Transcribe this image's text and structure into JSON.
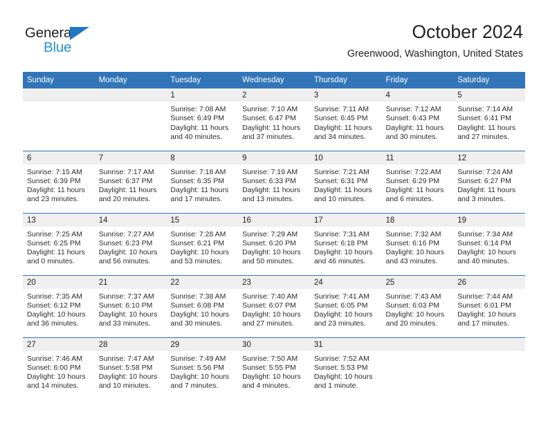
{
  "brand": {
    "name_top": "General",
    "name_bottom": "Blue",
    "triangle_color": "#1f77c2",
    "text_color": "#231f20",
    "blue_color": "#2a8fd8"
  },
  "header": {
    "month_title": "October 2024",
    "location": "Greenwood, Washington, United States"
  },
  "theme": {
    "header_blue": "#3275b8",
    "daynum_band": "#efefef",
    "text": "#222222"
  },
  "weekday_headers": [
    "Sunday",
    "Monday",
    "Tuesday",
    "Wednesday",
    "Thursday",
    "Friday",
    "Saturday"
  ],
  "labels": {
    "sunrise_prefix": "Sunrise:",
    "sunset_prefix": "Sunset:",
    "daylight_prefix": "Daylight:"
  },
  "weeks": [
    [
      {
        "day": ""
      },
      {
        "day": ""
      },
      {
        "day": "1",
        "sunrise": "Sunrise: 7:08 AM",
        "sunset": "Sunset: 6:49 PM",
        "daylight": "Daylight: 11 hours and 40 minutes."
      },
      {
        "day": "2",
        "sunrise": "Sunrise: 7:10 AM",
        "sunset": "Sunset: 6:47 PM",
        "daylight": "Daylight: 11 hours and 37 minutes."
      },
      {
        "day": "3",
        "sunrise": "Sunrise: 7:11 AM",
        "sunset": "Sunset: 6:45 PM",
        "daylight": "Daylight: 11 hours and 34 minutes."
      },
      {
        "day": "4",
        "sunrise": "Sunrise: 7:12 AM",
        "sunset": "Sunset: 6:43 PM",
        "daylight": "Daylight: 11 hours and 30 minutes."
      },
      {
        "day": "5",
        "sunrise": "Sunrise: 7:14 AM",
        "sunset": "Sunset: 6:41 PM",
        "daylight": "Daylight: 11 hours and 27 minutes."
      }
    ],
    [
      {
        "day": "6",
        "sunrise": "Sunrise: 7:15 AM",
        "sunset": "Sunset: 6:39 PM",
        "daylight": "Daylight: 11 hours and 23 minutes."
      },
      {
        "day": "7",
        "sunrise": "Sunrise: 7:17 AM",
        "sunset": "Sunset: 6:37 PM",
        "daylight": "Daylight: 11 hours and 20 minutes."
      },
      {
        "day": "8",
        "sunrise": "Sunrise: 7:18 AM",
        "sunset": "Sunset: 6:35 PM",
        "daylight": "Daylight: 11 hours and 17 minutes."
      },
      {
        "day": "9",
        "sunrise": "Sunrise: 7:19 AM",
        "sunset": "Sunset: 6:33 PM",
        "daylight": "Daylight: 11 hours and 13 minutes."
      },
      {
        "day": "10",
        "sunrise": "Sunrise: 7:21 AM",
        "sunset": "Sunset: 6:31 PM",
        "daylight": "Daylight: 11 hours and 10 minutes."
      },
      {
        "day": "11",
        "sunrise": "Sunrise: 7:22 AM",
        "sunset": "Sunset: 6:29 PM",
        "daylight": "Daylight: 11 hours and 6 minutes."
      },
      {
        "day": "12",
        "sunrise": "Sunrise: 7:24 AM",
        "sunset": "Sunset: 6:27 PM",
        "daylight": "Daylight: 11 hours and 3 minutes."
      }
    ],
    [
      {
        "day": "13",
        "sunrise": "Sunrise: 7:25 AM",
        "sunset": "Sunset: 6:25 PM",
        "daylight": "Daylight: 11 hours and 0 minutes."
      },
      {
        "day": "14",
        "sunrise": "Sunrise: 7:27 AM",
        "sunset": "Sunset: 6:23 PM",
        "daylight": "Daylight: 10 hours and 56 minutes."
      },
      {
        "day": "15",
        "sunrise": "Sunrise: 7:28 AM",
        "sunset": "Sunset: 6:21 PM",
        "daylight": "Daylight: 10 hours and 53 minutes."
      },
      {
        "day": "16",
        "sunrise": "Sunrise: 7:29 AM",
        "sunset": "Sunset: 6:20 PM",
        "daylight": "Daylight: 10 hours and 50 minutes."
      },
      {
        "day": "17",
        "sunrise": "Sunrise: 7:31 AM",
        "sunset": "Sunset: 6:18 PM",
        "daylight": "Daylight: 10 hours and 46 minutes."
      },
      {
        "day": "18",
        "sunrise": "Sunrise: 7:32 AM",
        "sunset": "Sunset: 6:16 PM",
        "daylight": "Daylight: 10 hours and 43 minutes."
      },
      {
        "day": "19",
        "sunrise": "Sunrise: 7:34 AM",
        "sunset": "Sunset: 6:14 PM",
        "daylight": "Daylight: 10 hours and 40 minutes."
      }
    ],
    [
      {
        "day": "20",
        "sunrise": "Sunrise: 7:35 AM",
        "sunset": "Sunset: 6:12 PM",
        "daylight": "Daylight: 10 hours and 36 minutes."
      },
      {
        "day": "21",
        "sunrise": "Sunrise: 7:37 AM",
        "sunset": "Sunset: 6:10 PM",
        "daylight": "Daylight: 10 hours and 33 minutes."
      },
      {
        "day": "22",
        "sunrise": "Sunrise: 7:38 AM",
        "sunset": "Sunset: 6:08 PM",
        "daylight": "Daylight: 10 hours and 30 minutes."
      },
      {
        "day": "23",
        "sunrise": "Sunrise: 7:40 AM",
        "sunset": "Sunset: 6:07 PM",
        "daylight": "Daylight: 10 hours and 27 minutes."
      },
      {
        "day": "24",
        "sunrise": "Sunrise: 7:41 AM",
        "sunset": "Sunset: 6:05 PM",
        "daylight": "Daylight: 10 hours and 23 minutes."
      },
      {
        "day": "25",
        "sunrise": "Sunrise: 7:43 AM",
        "sunset": "Sunset: 6:03 PM",
        "daylight": "Daylight: 10 hours and 20 minutes."
      },
      {
        "day": "26",
        "sunrise": "Sunrise: 7:44 AM",
        "sunset": "Sunset: 6:01 PM",
        "daylight": "Daylight: 10 hours and 17 minutes."
      }
    ],
    [
      {
        "day": "27",
        "sunrise": "Sunrise: 7:46 AM",
        "sunset": "Sunset: 6:00 PM",
        "daylight": "Daylight: 10 hours and 14 minutes."
      },
      {
        "day": "28",
        "sunrise": "Sunrise: 7:47 AM",
        "sunset": "Sunset: 5:58 PM",
        "daylight": "Daylight: 10 hours and 10 minutes."
      },
      {
        "day": "29",
        "sunrise": "Sunrise: 7:49 AM",
        "sunset": "Sunset: 5:56 PM",
        "daylight": "Daylight: 10 hours and 7 minutes."
      },
      {
        "day": "30",
        "sunrise": "Sunrise: 7:50 AM",
        "sunset": "Sunset: 5:55 PM",
        "daylight": "Daylight: 10 hours and 4 minutes."
      },
      {
        "day": "31",
        "sunrise": "Sunrise: 7:52 AM",
        "sunset": "Sunset: 5:53 PM",
        "daylight": "Daylight: 10 hours and 1 minute."
      },
      {
        "day": ""
      },
      {
        "day": ""
      }
    ]
  ]
}
